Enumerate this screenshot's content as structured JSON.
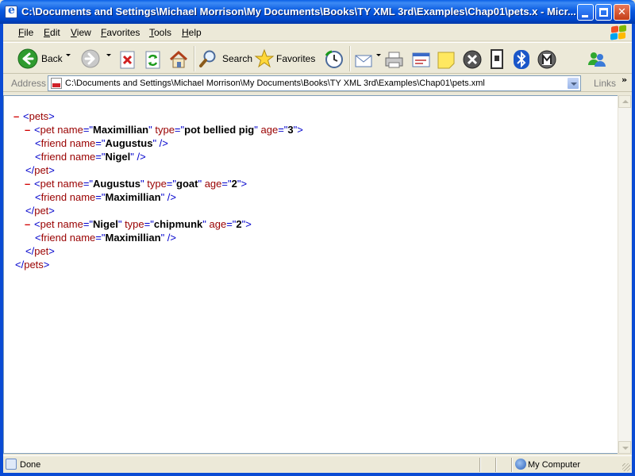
{
  "window": {
    "title": "C:\\Documents and Settings\\Michael Morrison\\My Documents\\Books\\TY XML 3rd\\Examples\\Chap01\\pets.x - Micr..."
  },
  "menu": [
    "File",
    "Edit",
    "View",
    "Favorites",
    "Tools",
    "Help"
  ],
  "toolbar": {
    "back": "Back",
    "search": "Search",
    "favorites": "Favorites",
    "icons": [
      "back-arrow-icon",
      "forward-arrow-icon",
      "stop-icon",
      "refresh-icon",
      "home-icon",
      "search-icon",
      "favorites-star-icon",
      "history-icon",
      "mail-icon",
      "print-icon",
      "edit-icon",
      "note-icon",
      "close-x-icon",
      "device-icon",
      "bluetooth-icon",
      "media-icon",
      "messenger-icon"
    ]
  },
  "address": {
    "label": "Address",
    "value": "C:\\Documents and Settings\\Michael Morrison\\My Documents\\Books\\TY XML 3rd\\Examples\\Chap01\\pets.xml",
    "links": "Links"
  },
  "xml": {
    "collapse": "–",
    "root": "pets",
    "pets": [
      {
        "name": "Maximillian",
        "type": "pot bellied pig",
        "age": "3",
        "friends": [
          "Augustus",
          "Nigel"
        ]
      },
      {
        "name": "Augustus",
        "type": "goat",
        "age": "2",
        "friends": [
          "Maximillian"
        ]
      },
      {
        "name": "Nigel",
        "type": "chipmunk",
        "age": "2",
        "friends": [
          "Maximillian"
        ]
      }
    ]
  },
  "status": {
    "text": "Done",
    "zone": "My Computer"
  },
  "colors": {
    "titlebar": "#0a5ae0",
    "xml_markup": "#0000cc",
    "xml_tag": "#990000",
    "collapse_minus": "#d10000"
  }
}
